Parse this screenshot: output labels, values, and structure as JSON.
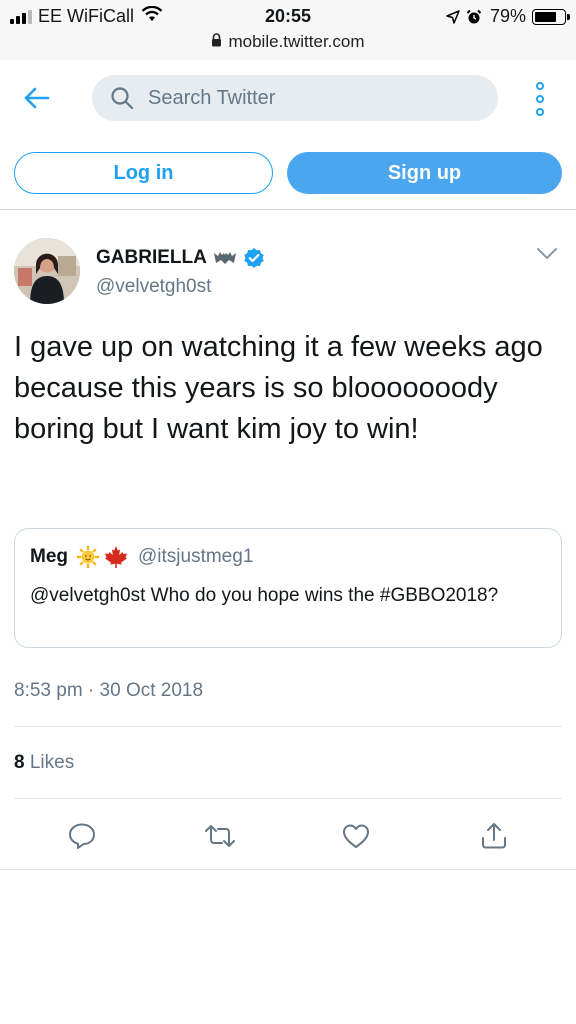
{
  "status_bar": {
    "carrier": "EE WiFiCall",
    "time": "20:55",
    "url": "mobile.twitter.com",
    "battery_percent_label": "79%",
    "battery_level": 0.79
  },
  "header": {
    "search_placeholder": "Search Twitter",
    "login_label": "Log in",
    "signup_label": "Sign up"
  },
  "tweet": {
    "author_name": "GABRIELLA",
    "author_handle": "@velvetgh0st",
    "text": "I gave up on watching it a few weeks ago because this years is so blooooooody boring but I want kim joy to win!",
    "timestamp": "8:53 pm · 30 Oct 2018",
    "likes_count": "8",
    "likes_label": "Likes"
  },
  "quote": {
    "name": "Meg",
    "handle": "@itsjustmeg1",
    "text": "@velvetgh0st Who do you hope wins the #GBBO2018?"
  },
  "colors": {
    "accent": "#1da1f2",
    "signup_bg": "#4aa6ee",
    "secondary_text": "#657786",
    "search_bg": "#e6ecf0",
    "border": "#ccd6dd"
  },
  "icons": [
    "signal-icon",
    "wifi-icon",
    "lock-icon",
    "location-arrow-icon",
    "alarm-clock-icon",
    "battery-icon",
    "back-arrow-icon",
    "search-icon",
    "more-options-icon",
    "bat-emoji-icon",
    "verified-badge-icon",
    "chevron-down-icon",
    "sun-emoji-icon",
    "maple-leaf-emoji-icon",
    "reply-icon",
    "retweet-icon",
    "like-icon",
    "share-icon"
  ]
}
